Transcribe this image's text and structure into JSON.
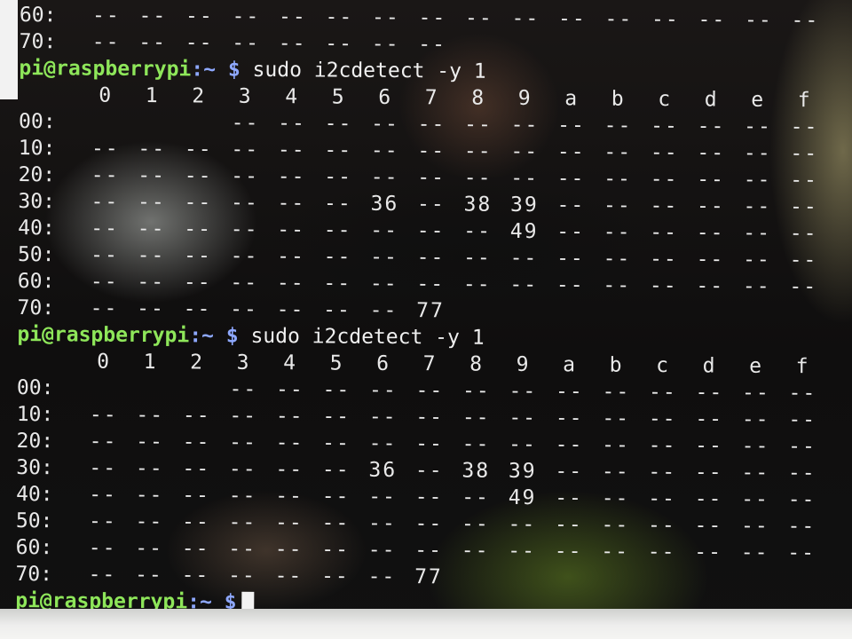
{
  "terminal": {
    "top_partial_rows": [
      {
        "label": "60:",
        "cells": [
          "--",
          "--",
          "--",
          "--",
          "--",
          "--",
          "--",
          "--",
          "--",
          "--",
          "--",
          "--",
          "--",
          "--",
          "--",
          "--"
        ]
      },
      {
        "label": "70:",
        "cells": [
          "--",
          "--",
          "--",
          "--",
          "--",
          "--",
          "--",
          "--"
        ]
      }
    ],
    "prompt_user_host": "pi@raspberrypi",
    "prompt_path": ":~ $",
    "scans": [
      {
        "command": "sudo i2cdetect -y 1",
        "column_headers": [
          "0",
          "1",
          "2",
          "3",
          "4",
          "5",
          "6",
          "7",
          "8",
          "9",
          "a",
          "b",
          "c",
          "d",
          "e",
          "f"
        ],
        "rows": [
          {
            "label": "00:",
            "cells": [
              "",
              "",
              "",
              "--",
              "--",
              "--",
              "--",
              "--",
              "--",
              "--",
              "--",
              "--",
              "--",
              "--",
              "--",
              "--"
            ]
          },
          {
            "label": "10:",
            "cells": [
              "--",
              "--",
              "--",
              "--",
              "--",
              "--",
              "--",
              "--",
              "--",
              "--",
              "--",
              "--",
              "--",
              "--",
              "--",
              "--"
            ]
          },
          {
            "label": "20:",
            "cells": [
              "--",
              "--",
              "--",
              "--",
              "--",
              "--",
              "--",
              "--",
              "--",
              "--",
              "--",
              "--",
              "--",
              "--",
              "--",
              "--"
            ]
          },
          {
            "label": "30:",
            "cells": [
              "--",
              "--",
              "--",
              "--",
              "--",
              "--",
              "36",
              "--",
              "38",
              "39",
              "--",
              "--",
              "--",
              "--",
              "--",
              "--"
            ]
          },
          {
            "label": "40:",
            "cells": [
              "--",
              "--",
              "--",
              "--",
              "--",
              "--",
              "--",
              "--",
              "--",
              "49",
              "--",
              "--",
              "--",
              "--",
              "--",
              "--"
            ]
          },
          {
            "label": "50:",
            "cells": [
              "--",
              "--",
              "--",
              "--",
              "--",
              "--",
              "--",
              "--",
              "--",
              "--",
              "--",
              "--",
              "--",
              "--",
              "--",
              "--"
            ]
          },
          {
            "label": "60:",
            "cells": [
              "--",
              "--",
              "--",
              "--",
              "--",
              "--",
              "--",
              "--",
              "--",
              "--",
              "--",
              "--",
              "--",
              "--",
              "--",
              "--"
            ]
          },
          {
            "label": "70:",
            "cells": [
              "--",
              "--",
              "--",
              "--",
              "--",
              "--",
              "--",
              "77"
            ]
          }
        ]
      },
      {
        "command": "sudo i2cdetect -y 1",
        "column_headers": [
          "0",
          "1",
          "2",
          "3",
          "4",
          "5",
          "6",
          "7",
          "8",
          "9",
          "a",
          "b",
          "c",
          "d",
          "e",
          "f"
        ],
        "rows": [
          {
            "label": "00:",
            "cells": [
              "",
              "",
              "",
              "--",
              "--",
              "--",
              "--",
              "--",
              "--",
              "--",
              "--",
              "--",
              "--",
              "--",
              "--",
              "--"
            ]
          },
          {
            "label": "10:",
            "cells": [
              "--",
              "--",
              "--",
              "--",
              "--",
              "--",
              "--",
              "--",
              "--",
              "--",
              "--",
              "--",
              "--",
              "--",
              "--",
              "--"
            ]
          },
          {
            "label": "20:",
            "cells": [
              "--",
              "--",
              "--",
              "--",
              "--",
              "--",
              "--",
              "--",
              "--",
              "--",
              "--",
              "--",
              "--",
              "--",
              "--",
              "--"
            ]
          },
          {
            "label": "30:",
            "cells": [
              "--",
              "--",
              "--",
              "--",
              "--",
              "--",
              "36",
              "--",
              "38",
              "39",
              "--",
              "--",
              "--",
              "--",
              "--",
              "--"
            ]
          },
          {
            "label": "40:",
            "cells": [
              "--",
              "--",
              "--",
              "--",
              "--",
              "--",
              "--",
              "--",
              "--",
              "49",
              "--",
              "--",
              "--",
              "--",
              "--",
              "--"
            ]
          },
          {
            "label": "50:",
            "cells": [
              "--",
              "--",
              "--",
              "--",
              "--",
              "--",
              "--",
              "--",
              "--",
              "--",
              "--",
              "--",
              "--",
              "--",
              "--",
              "--"
            ]
          },
          {
            "label": "60:",
            "cells": [
              "--",
              "--",
              "--",
              "--",
              "--",
              "--",
              "--",
              "--",
              "--",
              "--",
              "--",
              "--",
              "--",
              "--",
              "--",
              "--"
            ]
          },
          {
            "label": "70:",
            "cells": [
              "--",
              "--",
              "--",
              "--",
              "--",
              "--",
              "--",
              "77"
            ]
          }
        ]
      }
    ],
    "cursor_icon": "block-cursor-icon",
    "colors": {
      "user_host": "#8ee65a",
      "path": "#8ea8ff",
      "text": "#e9e9e9"
    }
  }
}
